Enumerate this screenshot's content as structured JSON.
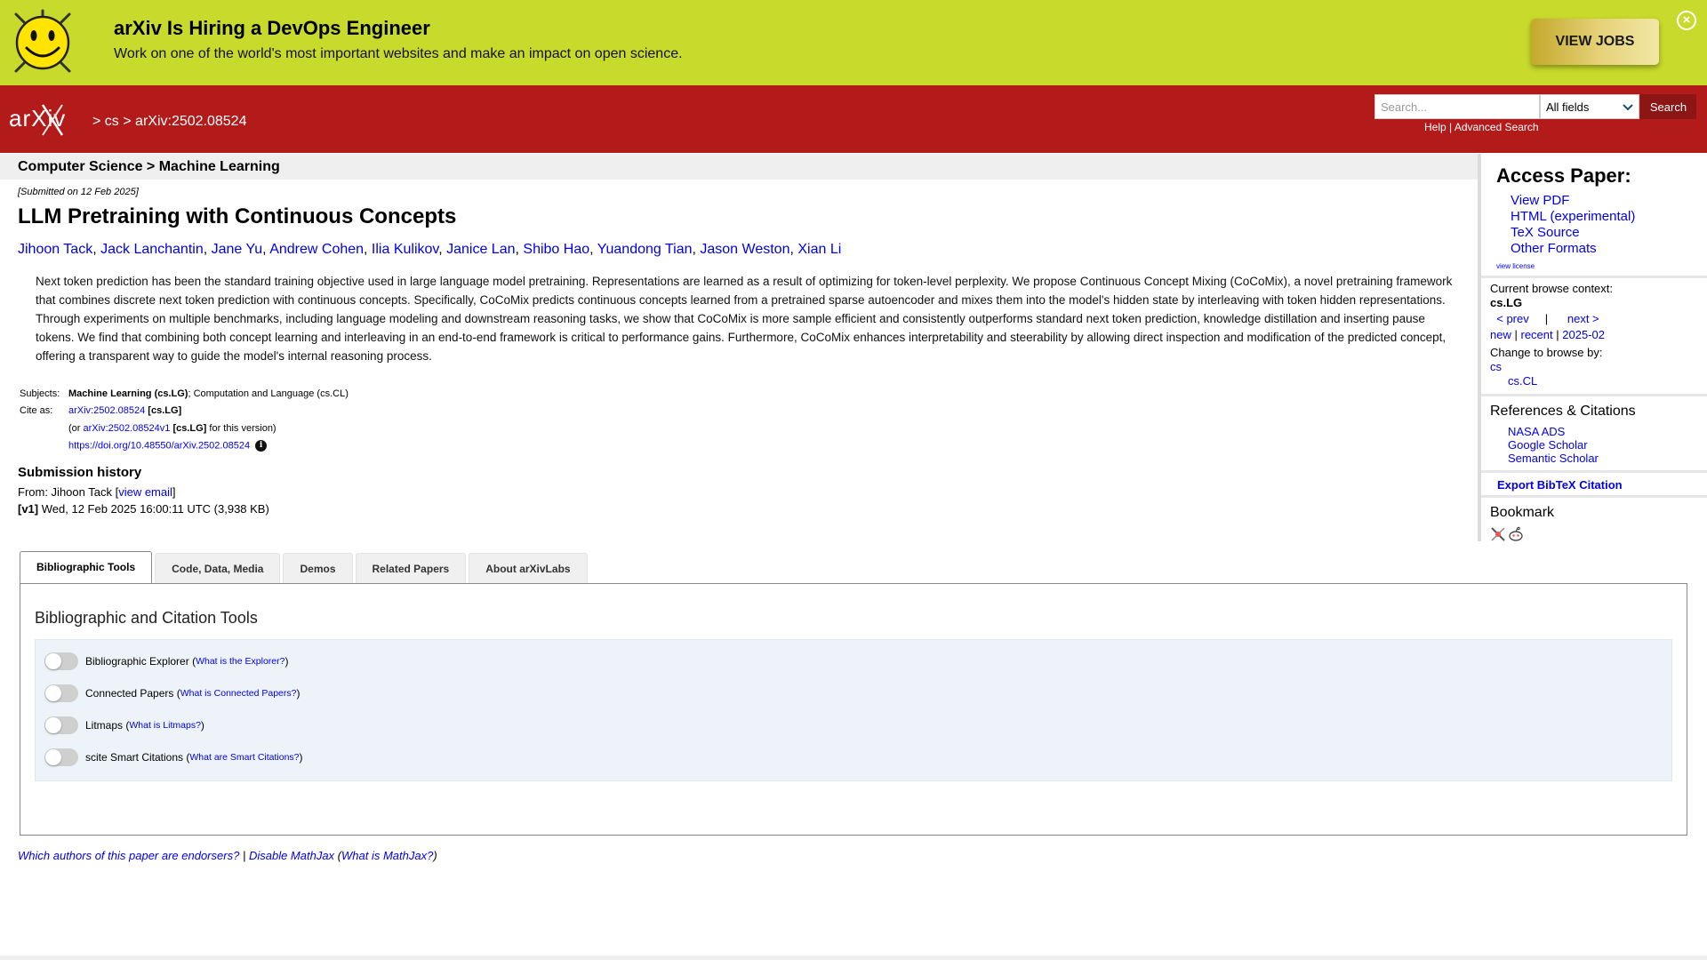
{
  "banner": {
    "title": "arXiv Is Hiring a DevOps Engineer",
    "subtitle": "Work on one of the world's most important websites and make an impact on open science.",
    "cta": "VIEW JOBS",
    "close_glyph": "×",
    "color": "#c8da2b"
  },
  "header": {
    "logo_text": "arXiv",
    "breadcrumb": {
      "sep1": ">",
      "cs": "cs",
      "sep2": ">",
      "paper": "arXiv:2502.08524"
    },
    "search_placeholder": "Search...",
    "field_selected": "All fields",
    "search_button": "Search",
    "help": "Help",
    "help_sep": "|",
    "advanced": "Advanced Search",
    "color": "#b31b1b"
  },
  "subject_header": "Computer Science > Machine Learning",
  "paper": {
    "submitted": "[Submitted on 12 Feb 2025]",
    "title": "LLM Pretraining with Continuous Concepts",
    "authors": [
      "Jihoon Tack",
      "Jack Lanchantin",
      "Jane Yu",
      "Andrew Cohen",
      "Ilia Kulikov",
      "Janice Lan",
      "Shibo Hao",
      "Yuandong Tian",
      "Jason Weston",
      "Xian Li"
    ],
    "abstract": "Next token prediction has been the standard training objective used in large language model pretraining. Representations are learned as a result of optimizing for token-level perplexity. We propose Continuous Concept Mixing (CoCoMix), a novel pretraining framework that combines discrete next token prediction with continuous concepts. Specifically, CoCoMix predicts continuous concepts learned from a pretrained sparse autoencoder and mixes them into the model's hidden state by interleaving with token hidden representations. Through experiments on multiple benchmarks, including language modeling and downstream reasoning tasks, we show that CoCoMix is more sample efficient and consistently outperforms standard next token prediction, knowledge distillation and inserting pause tokens. We find that combining both concept learning and interleaving in an end-to-end framework is critical to performance gains. Furthermore, CoCoMix enhances interpretability and steerability by allowing direct inspection and modification of the predicted concept, offering a transparent way to guide the model's internal reasoning process."
  },
  "meta": {
    "subjects_label": "Subjects:",
    "subjects_primary": "Machine Learning (cs.LG)",
    "subjects_rest": "; Computation and Language (cs.CL)",
    "cite_label": "Cite as:",
    "cite_id": "arXiv:2502.08524",
    "cite_cat": "[cs.LG]",
    "version_pre": "(or",
    "version_id": "arXiv:2502.08524v1",
    "version_cat": "[cs.LG]",
    "version_post": "for this version)",
    "doi": "https://doi.org/10.48550/arXiv.2502.08524",
    "info_glyph": "i"
  },
  "history": {
    "title": "Submission history",
    "from_pre": "From: Jihoon Tack [",
    "view_email": "view email",
    "from_post": "]",
    "version": "[v1]",
    "version_detail": "Wed, 12 Feb 2025 16:00:11 UTC (3,938 KB)"
  },
  "sidebar": {
    "access_title": "Access Paper:",
    "access_links": [
      "View PDF",
      "HTML (experimental)",
      "TeX Source",
      "Other Formats"
    ],
    "license": "view license",
    "browse_label": "Current browse context:",
    "browse_context": "cs.LG",
    "prev": "< prev",
    "nav_sep": "|",
    "next": "next >",
    "new": "new",
    "recent": "recent",
    "month": "2025-02",
    "change_label": "Change to browse by:",
    "change_cs": "cs",
    "change_cscl": "cs.CL",
    "refs_title": "References & Citations",
    "refs": [
      "NASA ADS",
      "Google Scholar",
      "Semantic Scholar"
    ],
    "export": "Export BibTeX Citation",
    "bookmark_title": "Bookmark"
  },
  "tabs": [
    "Bibliographic Tools",
    "Code, Data, Media",
    "Demos",
    "Related Papers",
    "About arXivLabs"
  ],
  "panel": {
    "title": "Bibliographic and Citation Tools",
    "toggles": [
      {
        "label": "Bibliographic Explorer",
        "help": "What is the Explorer?"
      },
      {
        "label": "Connected Papers",
        "help": "What is Connected Papers?"
      },
      {
        "label": "Litmaps",
        "help": "What is Litmaps?"
      },
      {
        "label": "scite Smart Citations",
        "help": "What are Smart Citations?"
      }
    ]
  },
  "footer": {
    "endorsers": "Which authors of this paper are endorsers?",
    "sep": "|",
    "disable_mathjax": "Disable MathJax",
    "what_mathjax": "What is MathJax?"
  }
}
